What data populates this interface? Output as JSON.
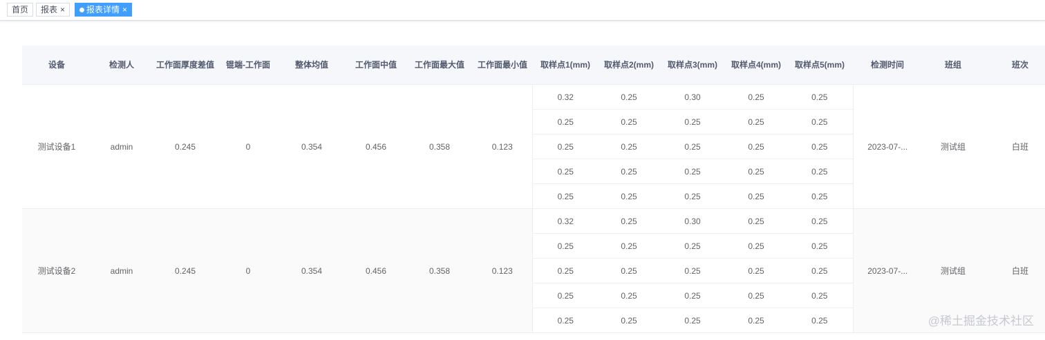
{
  "tabs": [
    {
      "label": "首页",
      "closable": false,
      "active": false
    },
    {
      "label": "报表",
      "closable": true,
      "active": false
    },
    {
      "label": "报表详情",
      "closable": true,
      "active": true
    }
  ],
  "close_glyph": "×",
  "table": {
    "headers": [
      "设备",
      "检测人",
      "工作面厚度差值",
      "锟端-工作面",
      "整体均值",
      "工作面中值",
      "工作面最大值",
      "工作面最小值",
      "取样点1(mm)",
      "取样点2(mm)",
      "取样点3(mm)",
      "取样点4(mm)",
      "取样点5(mm)",
      "检测时间",
      "班组",
      "班次"
    ],
    "groups": [
      {
        "device": "测试设备1",
        "inspector": "admin",
        "thickness_diff": "0.245",
        "roll_end": "0",
        "overall_mean": "0.354",
        "median": "0.456",
        "max": "0.358",
        "min": "0.123",
        "samples": [
          [
            "0.32",
            "0.25",
            "0.30",
            "0.25",
            "0.25"
          ],
          [
            "0.25",
            "0.25",
            "0.25",
            "0.25",
            "0.25"
          ],
          [
            "0.25",
            "0.25",
            "0.25",
            "0.25",
            "0.25"
          ],
          [
            "0.25",
            "0.25",
            "0.25",
            "0.25",
            "0.25"
          ],
          [
            "0.25",
            "0.25",
            "0.25",
            "0.25",
            "0.25"
          ]
        ],
        "time": "2023-07-...",
        "team": "测试组",
        "shift": "白班"
      },
      {
        "device": "测试设备2",
        "inspector": "admin",
        "thickness_diff": "0.245",
        "roll_end": "0",
        "overall_mean": "0.354",
        "median": "0.456",
        "max": "0.358",
        "min": "0.123",
        "samples": [
          [
            "0.32",
            "0.25",
            "0.30",
            "0.25",
            "0.25"
          ],
          [
            "0.25",
            "0.25",
            "0.25",
            "0.25",
            "0.25"
          ],
          [
            "0.25",
            "0.25",
            "0.25",
            "0.25",
            "0.25"
          ],
          [
            "0.25",
            "0.25",
            "0.25",
            "0.25",
            "0.25"
          ],
          [
            "0.25",
            "0.25",
            "0.25",
            "0.25",
            "0.25"
          ]
        ],
        "time": "2023-07-...",
        "team": "测试组",
        "shift": "白班"
      }
    ]
  },
  "watermark": "@稀土掘金技术社区",
  "colors": {
    "active_tab": "#409eff",
    "header_bg": "#f5f7fa",
    "border": "#ebeef5"
  }
}
